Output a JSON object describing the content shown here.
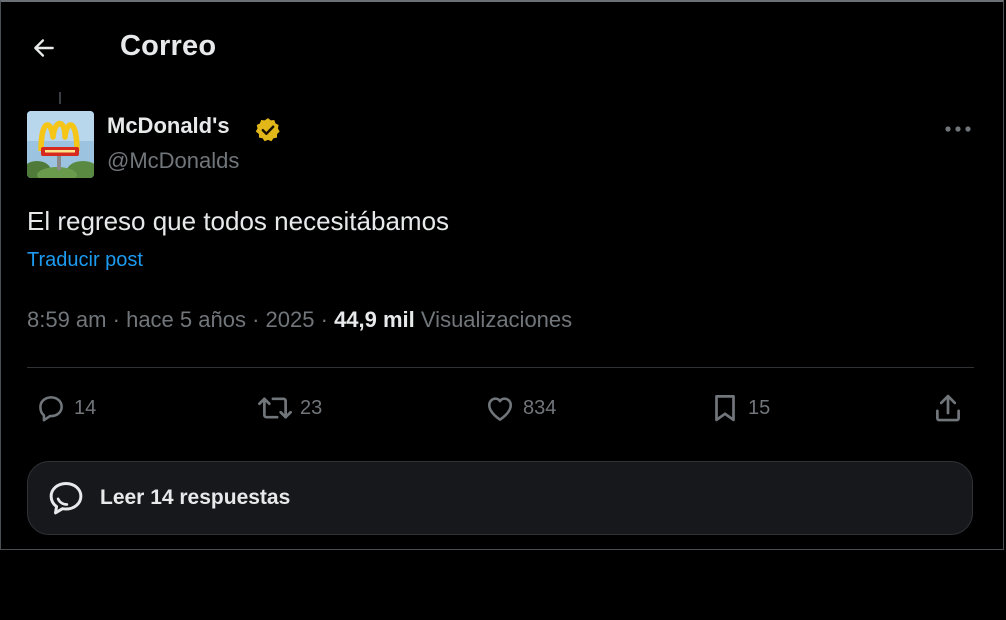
{
  "header": {
    "title": "Correo",
    "back_icon": "arrow-left-icon"
  },
  "post": {
    "author": {
      "display_name": "McDonald's",
      "handle": "@McDonalds",
      "verified_color": "#e2b719",
      "avatar_icon": "mcdonalds-logo"
    },
    "text": "El regreso que todos necesitábamos",
    "translate_label": "Traducir post",
    "time": "8:59 am",
    "ago": "hace 5 años",
    "year": "2025",
    "sep": "·",
    "views_count": "44,9 mil",
    "views_label": "Visualizaciones"
  },
  "actions": {
    "replies": "14",
    "reposts": "23",
    "likes": "834",
    "bookmarks": "15"
  },
  "replies_bar": {
    "label": "Leer 14 respuestas"
  },
  "colors": {
    "background": "#000000",
    "text_primary": "#e7e9ea",
    "text_secondary": "#71767b",
    "link": "#1d9bf0",
    "card": "#16181c",
    "border": "#2f3336"
  }
}
